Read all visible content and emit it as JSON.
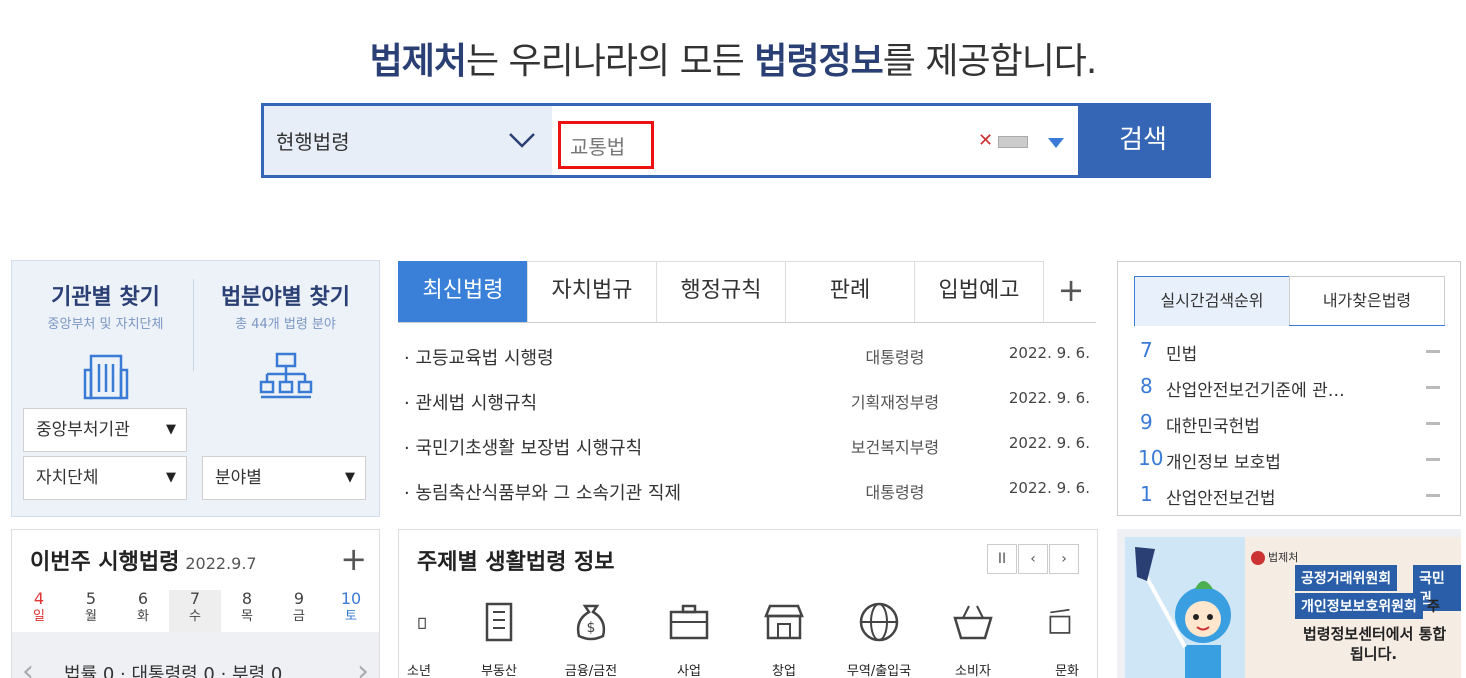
{
  "headline": {
    "brand": "법제처",
    "mid": "는 우리나라의 모든 ",
    "bold2": "법령정보",
    "end": "를 제공합니다."
  },
  "search": {
    "scope": "현행법령",
    "query": "교통법",
    "button": "검색"
  },
  "find": {
    "agency_title": "기관별 찾기",
    "agency_sub": "중앙부처 및 자치단체",
    "field_title": "법분야별 찾기",
    "field_sub": "총 44개 법령 분야",
    "sel_central": "중앙부처기관",
    "sel_local": "자치단체",
    "sel_field": "분야별",
    "arrow": "▼"
  },
  "tabs": {
    "items": [
      "최신법령",
      "자치법규",
      "행정규칙",
      "판례",
      "입법예고"
    ],
    "plus": "+"
  },
  "laws": [
    {
      "name": "· 고등교육법 시행령",
      "org": "대통령령",
      "date": "2022. 9. 6."
    },
    {
      "name": "· 관세법 시행규칙",
      "org": "기획재정부령",
      "date": "2022. 9. 6."
    },
    {
      "name": "· 국민기초생활 보장법 시행규칙",
      "org": "보건복지부령",
      "date": "2022. 9. 6."
    },
    {
      "name": "· 농림축산식품부와 그 소속기관 직제",
      "org": "대통령령",
      "date": "2022. 9. 6."
    }
  ],
  "ranks": {
    "tab_live": "실시간검색순위",
    "tab_mine": "내가찾은법령",
    "items": [
      {
        "no": "7",
        "name": "민법"
      },
      {
        "no": "8",
        "name": "산업안전보건기준에 관…"
      },
      {
        "no": "9",
        "name": "대한민국헌법"
      },
      {
        "no": "10",
        "name": "개인정보 보호법"
      },
      {
        "no": "1",
        "name": "산업안전보건법"
      }
    ]
  },
  "week": {
    "title": "이번주 시행법령",
    "date": "2022.9.7",
    "plus": "+",
    "days": [
      {
        "d": "4",
        "w": "일"
      },
      {
        "d": "5",
        "w": "월"
      },
      {
        "d": "6",
        "w": "화"
      },
      {
        "d": "7",
        "w": "수"
      },
      {
        "d": "8",
        "w": "목"
      },
      {
        "d": "9",
        "w": "금"
      },
      {
        "d": "10",
        "w": "토"
      }
    ],
    "summary": "법률 0 · 대통령령 0 · 부령 0",
    "prev": "‹",
    "next": "›"
  },
  "topic": {
    "title": "주제별 생활법령 정보",
    "pause": "II",
    "prev": "‹",
    "next": "›",
    "items": [
      "소년",
      "부동산",
      "금융/금전",
      "사업",
      "창업",
      "무역/출입국",
      "소비자",
      "문화"
    ]
  },
  "banner": {
    "tag1": "공정거래위원회",
    "tag2": "국민권",
    "tag3": "개인정보보호위원회",
    "tag4": "주",
    "line3": "법령정보센터에서 통합",
    "line4": "됩니다.",
    "logo": "법제처"
  },
  "colors": {
    "brand": "#2a3f73",
    "accent": "#3466b5",
    "tab_active": "#3a80d9"
  }
}
